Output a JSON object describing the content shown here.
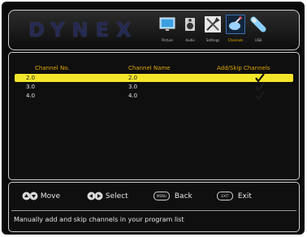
{
  "header": {
    "logo": "DYNEX",
    "tabs": [
      {
        "label": "Picture",
        "icon": "picture-icon",
        "active": false
      },
      {
        "label": "Audio",
        "icon": "audio-icon",
        "active": false
      },
      {
        "label": "Settings",
        "icon": "settings-icon",
        "active": false
      },
      {
        "label": "Channels",
        "icon": "channels-icon",
        "active": true
      },
      {
        "label": "USB",
        "icon": "usb-icon",
        "active": false
      }
    ]
  },
  "table": {
    "columns": [
      "Channel No.",
      "Channel Name",
      "Add/Skip Channels"
    ],
    "rows": [
      {
        "number": "2.0",
        "name": "2.0",
        "added": true,
        "selected": true
      },
      {
        "number": "3.0",
        "name": "3.0",
        "added": true,
        "selected": false
      },
      {
        "number": "4.0",
        "name": "4.0",
        "added": true,
        "selected": false
      }
    ]
  },
  "footer": {
    "hints": [
      {
        "label": "Move",
        "icon": "up-down-arrows-icon"
      },
      {
        "label": "Select",
        "icon": "left-right-arrows-icon"
      },
      {
        "label": "Back",
        "key": "MENU"
      },
      {
        "label": "Exit",
        "key": "EXIT"
      }
    ],
    "description": "Manually add and skip channels in your program list"
  },
  "colors": {
    "selection": "#f3e62a",
    "header_text": "#e2a800",
    "active_tab": "#f0b000"
  }
}
